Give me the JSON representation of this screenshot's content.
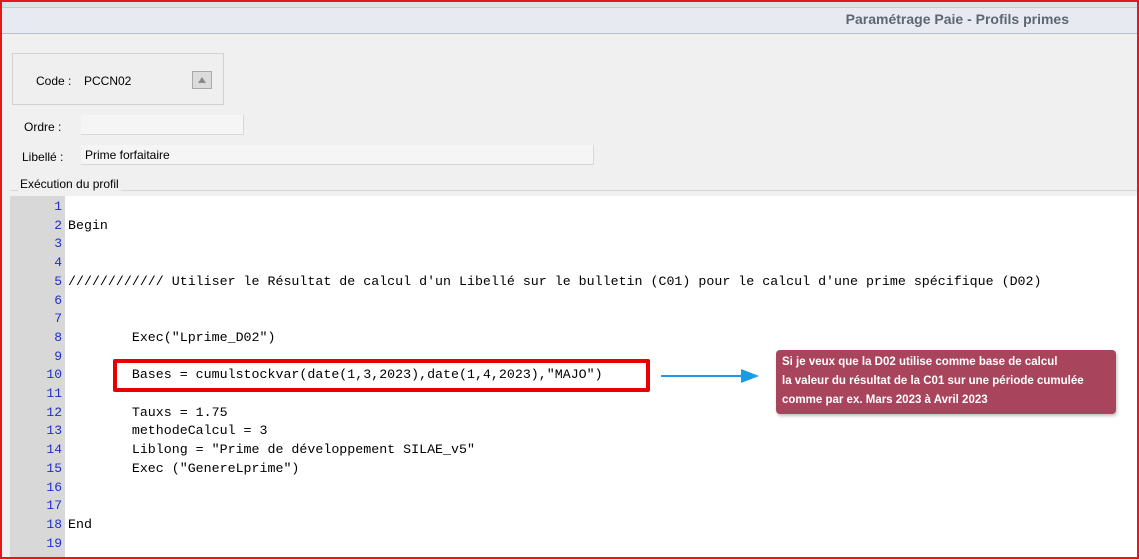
{
  "window": {
    "title": "Paramétrage Paie - Profils primes"
  },
  "form": {
    "code_label": "Code :",
    "code_value": "PCCN02",
    "ordre_label": "Ordre :",
    "ordre_value": "",
    "libelle_label": "Libellé :",
    "libelle_value": "Prime forfaitaire",
    "section_label": "Exécution du profil"
  },
  "editor": {
    "lines": [
      {
        "n": "1",
        "text": ""
      },
      {
        "n": "2",
        "text": "Begin"
      },
      {
        "n": "3",
        "text": ""
      },
      {
        "n": "4",
        "text": ""
      },
      {
        "n": "5",
        "text": "//////////// Utiliser le Résultat de calcul d'un Libellé sur le bulletin (C01) pour le calcul d'une prime spécifique (D02)"
      },
      {
        "n": "6",
        "text": ""
      },
      {
        "n": "7",
        "text": ""
      },
      {
        "n": "8",
        "text": "        Exec(\"Lprime_D02\")"
      },
      {
        "n": "9",
        "text": ""
      },
      {
        "n": "10",
        "text": "        Bases = cumulstockvar(date(1,3,2023),date(1,4,2023),\"MAJO\")"
      },
      {
        "n": "11",
        "text": ""
      },
      {
        "n": "12",
        "text": "        Tauxs = 1.75"
      },
      {
        "n": "13",
        "text": "        methodeCalcul = 3"
      },
      {
        "n": "14",
        "text": "        Liblong = \"Prime de développement SILAE_v5\""
      },
      {
        "n": "15",
        "text": "        Exec (\"GenereLprime\")"
      },
      {
        "n": "16",
        "text": ""
      },
      {
        "n": "17",
        "text": ""
      },
      {
        "n": "18",
        "text": "End"
      },
      {
        "n": "19",
        "text": ""
      }
    ]
  },
  "annotation": {
    "lines": [
      "Si je veux que la D02 utilise comme base de calcul",
      "la valeur du résultat de la C01 sur une période cumulée",
      "comme par ex. Mars 2023 à Avril 2023"
    ],
    "color": "#a8455c",
    "highlight_color": "#e60000",
    "arrow_color": "#1a9be6"
  }
}
